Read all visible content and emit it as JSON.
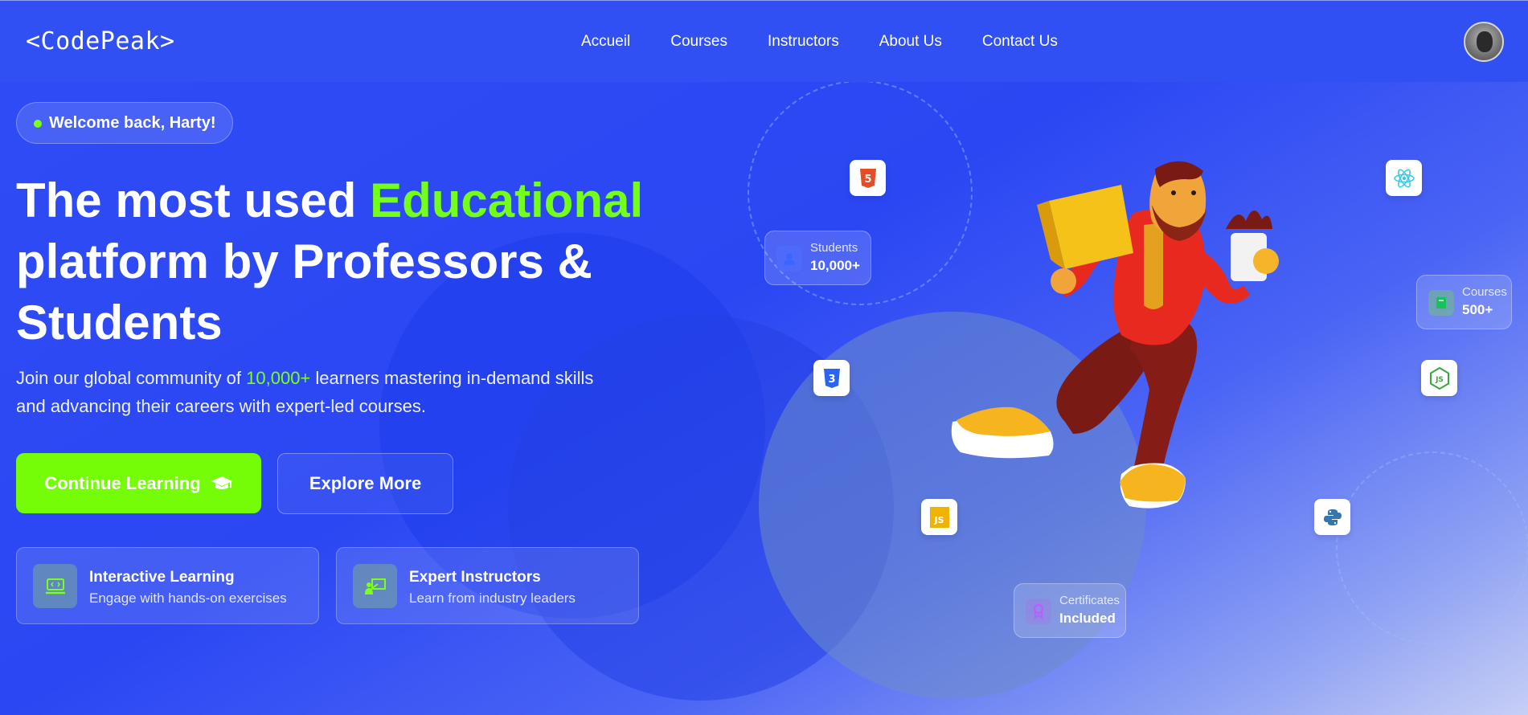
{
  "header": {
    "logo": "<CodePeak>",
    "nav": [
      "Accueil",
      "Courses",
      "Instructors",
      "About Us",
      "Contact Us"
    ]
  },
  "hero": {
    "welcome": "Welcome back, Harty!",
    "headline_part1": "The most used ",
    "headline_highlight": "Educational",
    "headline_part2": "platform by Professors & Students",
    "subtitle_part1": "Join our global community of ",
    "subtitle_highlight": "10,000+",
    "subtitle_part2": " learners mastering in-demand skills and advancing their careers with expert-led courses.",
    "primary_button": "Continue Learning",
    "secondary_button": "Explore More"
  },
  "features": [
    {
      "title": "Interactive Learning",
      "desc": "Engage with hands-on exercises",
      "icon": "laptop-code-icon"
    },
    {
      "title": "Expert Instructors",
      "desc": "Learn from industry leaders",
      "icon": "teacher-board-icon"
    }
  ],
  "stats": {
    "students": {
      "label": "Students",
      "value": "10,000+"
    },
    "courses": {
      "label": "Courses",
      "value": "500+"
    },
    "certificates": {
      "label": "Certificates",
      "value": "Included"
    }
  },
  "tech_icons": [
    "html5-icon",
    "react-icon",
    "css3-icon",
    "nodejs-icon",
    "javascript-icon",
    "python-icon"
  ],
  "colors": {
    "background": "#2f4cf6",
    "accent_green": "#74fd06",
    "highlight_green": "#74ff1a"
  }
}
